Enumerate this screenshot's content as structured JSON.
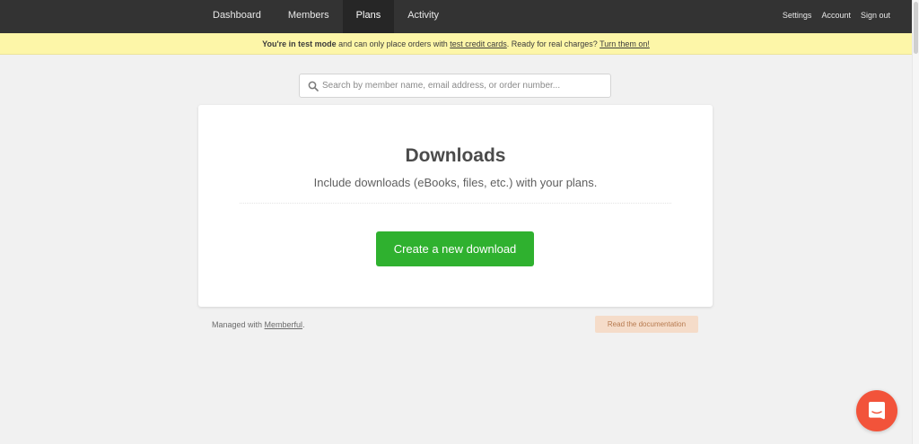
{
  "nav": {
    "items": [
      {
        "label": "Dashboard",
        "active": false
      },
      {
        "label": "Members",
        "active": false
      },
      {
        "label": "Plans",
        "active": true
      },
      {
        "label": "Activity",
        "active": false
      }
    ],
    "right": {
      "settings": "Settings",
      "account": "Account",
      "sign_out": "Sign out"
    }
  },
  "banner": {
    "bold": "You're in test mode",
    "text1": " and can only place orders with ",
    "link1": "test credit cards",
    "text2": ". Ready for real charges? ",
    "link2": "Turn them on!"
  },
  "search": {
    "placeholder": "Search by member name, email address, or order number...",
    "value": ""
  },
  "card": {
    "title": "Downloads",
    "subtitle": "Include downloads (eBooks, files, etc.) with your plans.",
    "button_label": "Create a new download"
  },
  "footer": {
    "managed_text": "Managed with ",
    "managed_link": "Memberful",
    "managed_end": ".",
    "doc_button": "Read the documentation"
  },
  "colors": {
    "nav_bg": "#333333",
    "banner_bg": "#fdf6a8",
    "primary_button": "#2fb12f",
    "doc_button_bg": "#f5dcc9",
    "chat_launcher": "#f2533a"
  }
}
